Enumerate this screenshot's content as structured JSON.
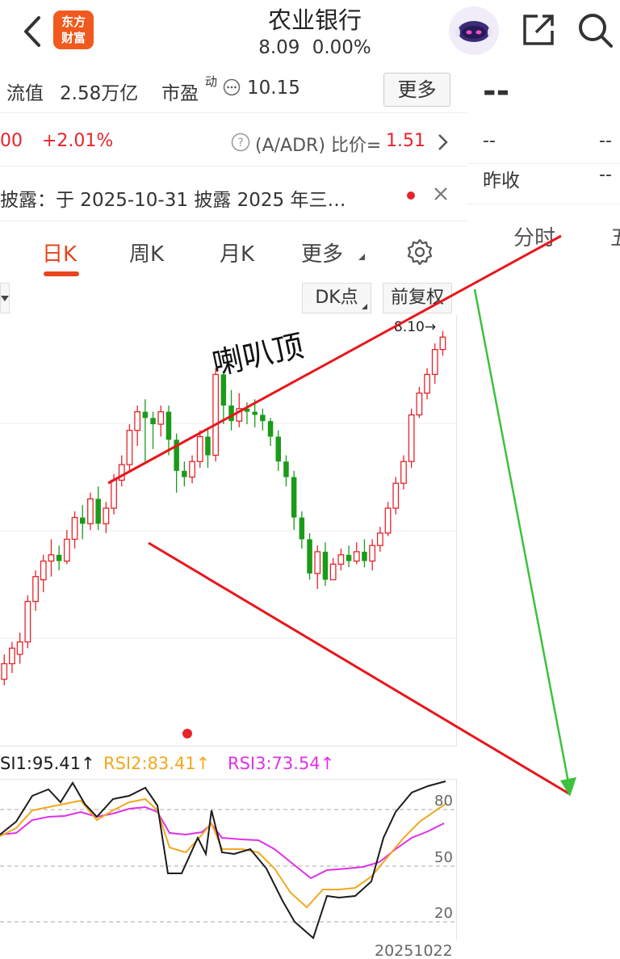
{
  "header": {
    "logo_line1": "东方",
    "logo_line2": "财富",
    "title": "农业银行",
    "price": "8.09",
    "change": "0.00%"
  },
  "stats": {
    "mcap_label": "流值",
    "mcap_value": "2.58万亿",
    "pe_label": "市盈",
    "pe_sup": "动",
    "pe_value": "10.15",
    "more_label": "更多"
  },
  "adr": {
    "left_value": "00",
    "pct": "+2.01%",
    "label": "(A/ADR) 比价=",
    "value": "1.51"
  },
  "notice": {
    "text": "披露：于 2025-10-31 披露 2025 年三…"
  },
  "side_panel": {
    "big": "--",
    "r1_left": "--",
    "r1_right": "--",
    "r2_left": "昨收",
    "r2_right": "--"
  },
  "tabs": [
    "日K",
    "周K",
    "月K",
    "更多"
  ],
  "right_tabs": [
    "分时",
    "五"
  ],
  "toolbar": {
    "dk_label": "DK点",
    "fq_label": "前复权"
  },
  "annotation": {
    "text": "喇叭顶",
    "price_tag": "8.10→"
  },
  "rsi": {
    "rsi1": "SI1:95.41↑",
    "rsi2": "RSI2:83.41↑",
    "rsi3": "RSI3:73.54↑",
    "levels": [
      "80",
      "50",
      "20"
    ],
    "date": "20251022"
  },
  "colors": {
    "up": "#e8232b",
    "down": "#1a9b1a",
    "accent": "#e8451e",
    "rsi1": "#1c1c1c",
    "rsi2": "#f2a81d",
    "rsi3": "#e030e8",
    "annotation": "#e8161b",
    "arrow": "#3cc23c"
  },
  "chart_data": {
    "type": "candlestick",
    "description_free": true,
    "candles": [
      [
        7.0,
        7.05,
        7.08,
        6.98
      ],
      [
        7.05,
        7.1,
        7.12,
        7.02
      ],
      [
        7.08,
        7.12,
        7.15,
        7.05
      ],
      [
        7.12,
        7.25,
        7.27,
        7.1
      ],
      [
        7.25,
        7.33,
        7.35,
        7.22
      ],
      [
        7.32,
        7.38,
        7.4,
        7.28
      ],
      [
        7.38,
        7.4,
        7.45,
        7.33
      ],
      [
        7.4,
        7.38,
        7.43,
        7.35
      ],
      [
        7.38,
        7.45,
        7.48,
        7.37
      ],
      [
        7.45,
        7.52,
        7.54,
        7.42
      ],
      [
        7.52,
        7.5,
        7.56,
        7.45
      ],
      [
        7.5,
        7.58,
        7.6,
        7.48
      ],
      [
        7.58,
        7.5,
        7.62,
        7.48
      ],
      [
        7.5,
        7.55,
        7.57,
        7.47
      ],
      [
        7.55,
        7.64,
        7.66,
        7.53
      ],
      [
        7.64,
        7.69,
        7.72,
        7.62
      ],
      [
        7.69,
        7.8,
        7.82,
        7.67
      ],
      [
        7.8,
        7.86,
        7.88,
        7.75
      ],
      [
        7.86,
        7.84,
        7.9,
        7.7
      ],
      [
        7.84,
        7.82,
        7.86,
        7.74
      ],
      [
        7.82,
        7.86,
        7.88,
        7.78
      ],
      [
        7.86,
        7.77,
        7.88,
        7.72
      ],
      [
        7.77,
        7.67,
        7.79,
        7.6
      ],
      [
        7.67,
        7.65,
        7.7,
        7.62
      ],
      [
        7.65,
        7.7,
        7.72,
        7.63
      ],
      [
        7.7,
        7.78,
        7.8,
        7.68
      ],
      [
        7.78,
        7.72,
        7.81,
        7.68
      ],
      [
        7.72,
        7.98,
        8.0,
        7.7
      ],
      [
        7.98,
        7.88,
        7.99,
        7.82
      ],
      [
        7.88,
        7.83,
        7.93,
        7.8
      ],
      [
        7.83,
        7.87,
        7.92,
        7.81
      ],
      [
        7.87,
        7.86,
        7.89,
        7.82
      ],
      [
        7.86,
        7.85,
        7.9,
        7.81
      ],
      [
        7.85,
        7.83,
        7.87,
        7.8
      ],
      [
        7.83,
        7.78,
        7.84,
        7.75
      ],
      [
        7.78,
        7.7,
        7.8,
        7.67
      ],
      [
        7.7,
        7.65,
        7.72,
        7.62
      ],
      [
        7.65,
        7.52,
        7.67,
        7.48
      ],
      [
        7.52,
        7.45,
        7.54,
        7.42
      ],
      [
        7.45,
        7.34,
        7.47,
        7.32
      ],
      [
        7.34,
        7.41,
        7.43,
        7.29
      ],
      [
        7.41,
        7.32,
        7.44,
        7.3
      ],
      [
        7.32,
        7.37,
        7.39,
        7.32
      ],
      [
        7.37,
        7.4,
        7.42,
        7.35
      ],
      [
        7.4,
        7.38,
        7.43,
        7.36
      ],
      [
        7.38,
        7.41,
        7.44,
        7.37
      ],
      [
        7.41,
        7.38,
        7.45,
        7.36
      ],
      [
        7.38,
        7.43,
        7.45,
        7.35
      ],
      [
        7.43,
        7.47,
        7.49,
        7.41
      ],
      [
        7.47,
        7.55,
        7.57,
        7.46
      ],
      [
        7.55,
        7.63,
        7.65,
        7.53
      ],
      [
        7.63,
        7.7,
        7.72,
        7.61
      ],
      [
        7.7,
        7.85,
        7.87,
        7.68
      ],
      [
        7.85,
        7.92,
        7.94,
        7.84
      ],
      [
        7.92,
        7.98,
        8.0,
        7.9
      ],
      [
        7.98,
        8.06,
        8.08,
        7.95
      ],
      [
        8.06,
        8.1,
        8.12,
        8.04
      ]
    ],
    "rsi_levels": [
      20,
      50,
      80
    ],
    "last_date": "20251022"
  }
}
